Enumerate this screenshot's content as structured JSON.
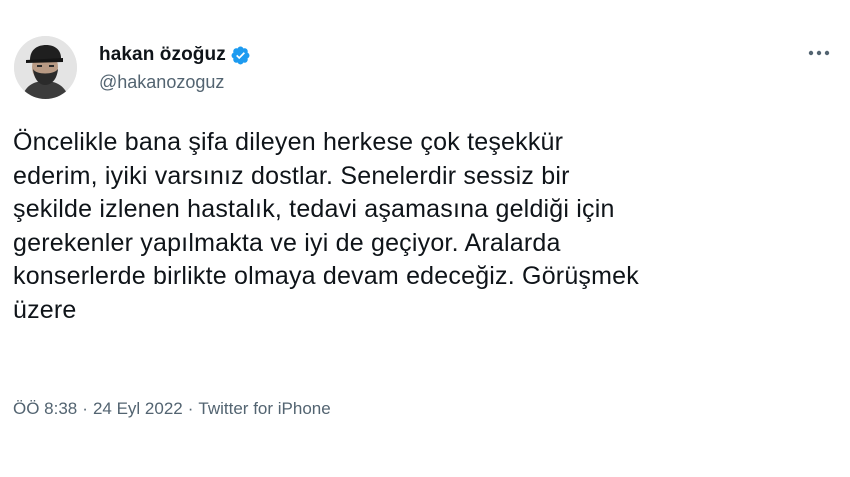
{
  "user": {
    "display_name": "hakan özoğuz",
    "handle": "@hakanozoguz",
    "verified_icon": "verified-badge-icon",
    "verified_color": "#1d9bf0"
  },
  "menu": {
    "more_icon": "more-horizontal-icon"
  },
  "tweet": {
    "text": "Öncelikle bana şifa dileyen herkese çok teşekkür\nederim, iyiki varsınız dostlar. Senelerdir sessiz bir\nşekilde izlenen hastalık, tedavi aşamasına geldiği için\ngerekenler yapılmakta ve iyi de geçiyor. Aralarda\nkonserlerde birlikte olmaya devam edeceğiz. Görüşmek\nüzere",
    "time": "ÖÖ 8:38",
    "separator": "·",
    "date": "24 Eyl 2022",
    "source": "Twitter for iPhone"
  },
  "colors": {
    "text": "#0f1419",
    "secondary": "#536471",
    "background": "#ffffff"
  }
}
